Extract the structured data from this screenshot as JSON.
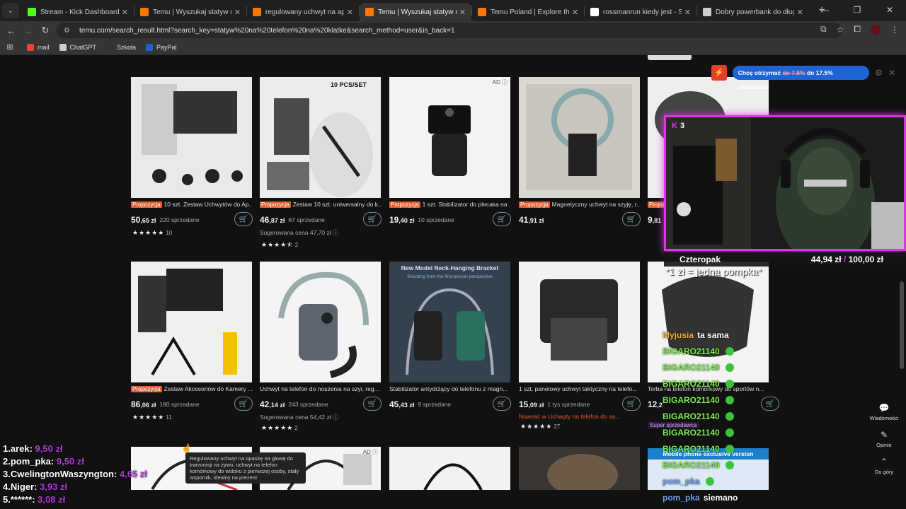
{
  "tabs": [
    {
      "title": "Stream - Kick Dashboard",
      "icon": "kick-icon",
      "color": "#53fc18",
      "active": false
    },
    {
      "title": "Temu | Wyszukaj statyw na telefon",
      "icon": "temu-icon",
      "color": "#fb7701",
      "active": false
    },
    {
      "title": "regulowany uchwyt na aparat",
      "icon": "temu-icon",
      "color": "#fb7701",
      "active": false
    },
    {
      "title": "Temu | Wyszukaj statyw na telefon",
      "icon": "temu-icon",
      "color": "#fb7701",
      "active": true
    },
    {
      "title": "Temu Poland | Explore the Latest",
      "icon": "temu-icon",
      "color": "#fb7701",
      "active": false
    },
    {
      "title": "rossmanrun kiedy jest - Szukaj",
      "icon": "google-icon",
      "color": "#ffffff",
      "active": false
    },
    {
      "title": "Dobry powerbank do długiego",
      "icon": "globe-icon",
      "color": "#cccccc",
      "active": false
    }
  ],
  "address": {
    "url": "temu.com/search_result.html?search_key=statyw%20na%20telefon%20na%20klatke&search_method=user&is_back=1"
  },
  "bookmarks": [
    {
      "label": "mail",
      "color": "#ea4335"
    },
    {
      "label": "ChatGPT",
      "color": "#cccccc"
    },
    {
      "label": "Szkoła",
      "color": "#333333"
    },
    {
      "label": "PayPal",
      "color": "#1d63c9"
    }
  ],
  "products": [
    {
      "title": "10 szt. Zestaw Uchwytów do Ap...",
      "tag": "Propozycja",
      "price_main": "50",
      "price_dec": ",65 zł",
      "sold": "220 sprzedane",
      "suggested": "",
      "stars": "★★★★★",
      "rating_count": "10",
      "ad": false
    },
    {
      "title": "Zestaw 10 szt. uniwersalny do k...",
      "tag": "Propozycja",
      "price_main": "46",
      "price_dec": ",87 zł",
      "sold": "67 sprzedane",
      "suggested": "Sugerowana cena 47,70 zł ⓘ",
      "stars": "★★★★⯪",
      "rating_count": "2",
      "ad": false,
      "image_text": "10 PCS/SET"
    },
    {
      "title": "1 szt. Stabilizator do plecaka na ...",
      "tag": "Propozycja",
      "price_main": "19",
      "price_dec": ",40 zł",
      "sold": "10 sprzedane",
      "suggested": "",
      "stars": "",
      "rating_count": "",
      "ad": true
    },
    {
      "title": "Magnetyczny uchwyt na szyję, r...",
      "tag": "Propozycja",
      "price_main": "41",
      "price_dec": ",91 zł",
      "sold": "",
      "suggested": "",
      "stars": "",
      "rating_count": "",
      "ad": false
    },
    {
      "title": "",
      "tag": "Propo",
      "price_main": "9",
      "price_dec": ",81",
      "sold": "",
      "suggested": "",
      "stars": "",
      "rating_count": "",
      "ad": false
    },
    {
      "title": "Zestaw Akcesoriów do Kamery ...",
      "tag": "Propozycja",
      "price_main": "86",
      "price_dec": ",06 zł",
      "sold": "180 sprzedane",
      "suggested": "",
      "stars": "★★★★★",
      "rating_count": "11",
      "ad": false
    },
    {
      "title": "Uchwyt na telefon do noszenia na szyi, reg...",
      "tag": "",
      "price_main": "42",
      "price_dec": ",14 zł",
      "sold": "243 sprzedane",
      "suggested": "Sugerowana cena 54,42 zł ⓘ",
      "stars": "★★★★★",
      "rating_count": "2",
      "ad": false
    },
    {
      "title": "Stabilizator antydrżący do telefonu z magn...",
      "tag": "",
      "price_main": "45",
      "price_dec": ",43 zł",
      "sold": "9 sprzedane",
      "suggested": "",
      "stars": "",
      "rating_count": "",
      "ad": false,
      "image_text": "New Model Neck-Hanging Bracket",
      "image_sub": "Shooting from the first-person perspective"
    },
    {
      "title": "1 szt. panelowy uchwyt taktyczny na telefo...",
      "tag": "",
      "price_main": "15",
      "price_dec": ",09 zł",
      "sold": "1 tys sprzedane",
      "suggested": "Nowość w Uchwyty na telefon do sa...",
      "stars": "★★★★★",
      "rating_count": "27",
      "ad": false
    },
    {
      "title": "Torba na telefon komórkowy do sportów n...",
      "tag": "",
      "price_main": "12",
      "price_dec": ",2",
      "sold": "",
      "suggested": "",
      "stars": "",
      "rating_count": "",
      "ad": false
    }
  ],
  "cashback": {
    "logo": "⚡",
    "text_pre": "Chcę otrzymać ",
    "old": "do 7.5%",
    "text_post": " do 17.5% cashbacku"
  },
  "stream": {
    "viewers": "3"
  },
  "donation_goal": {
    "label": "Czteropak",
    "current": "44,94 zł",
    "goal": "100,00 zł"
  },
  "pompka_text": "*1 zł = jedna pompka*",
  "chat": [
    {
      "user": "Myjusia",
      "text": "ta sama",
      "color": "#f0b13a"
    },
    {
      "user": "BIGARO21140",
      "text": "",
      "color": "#7cf04a"
    },
    {
      "user": "BIGARO21140",
      "text": "",
      "color": "#7cf04a"
    },
    {
      "user": "BIGARO21140",
      "text": "",
      "color": "#7cf04a"
    },
    {
      "user": "BIGARO21140",
      "text": "",
      "color": "#7cf04a"
    },
    {
      "user": "BIGARO21140",
      "text": "",
      "color": "#7cf04a"
    },
    {
      "user": "BIGARO21140",
      "text": "",
      "color": "#7cf04a"
    },
    {
      "user": "BIGARO21140",
      "text": "",
      "color": "#7cf04a"
    },
    {
      "user": "BIGARO21140",
      "text": "",
      "color": "#7cf04a"
    },
    {
      "user": "pom_pka",
      "text": "",
      "color": "#6fa3f0"
    },
    {
      "user": "pom_pka",
      "text": "siemano",
      "color": "#6fa3f0"
    }
  ],
  "leaderboard": [
    {
      "rank": "1.arek:",
      "value": "9,50 zł"
    },
    {
      "rank": "2.pom_pka:",
      "value": "9,50 zł"
    },
    {
      "rank": "3.CwelingtonWaszyngton:",
      "value": "4,65 zł"
    },
    {
      "rank": "4.Niger:",
      "value": "3,93 zł"
    },
    {
      "rank": "5.******:",
      "value": "3,08 zł"
    }
  ],
  "tooltip": "Regulowany uchwyt na opaskę na głowę do transmisji na żywo, uchwyt na telefon komórkowy do widoku z pierwszej osoby, stały wspornik, idealny na prezent",
  "right_nav": [
    {
      "label": "Wiadomości",
      "icon": "chat-icon"
    },
    {
      "label": "Opinie",
      "icon": "edit-icon"
    },
    {
      "label": "Do góry",
      "icon": "arrow-up-icon"
    }
  ],
  "mobile_banner": "Mobile phone exclusive version",
  "super_seller": "Super sprzedawca",
  "ad_label": "AD ⓘ"
}
